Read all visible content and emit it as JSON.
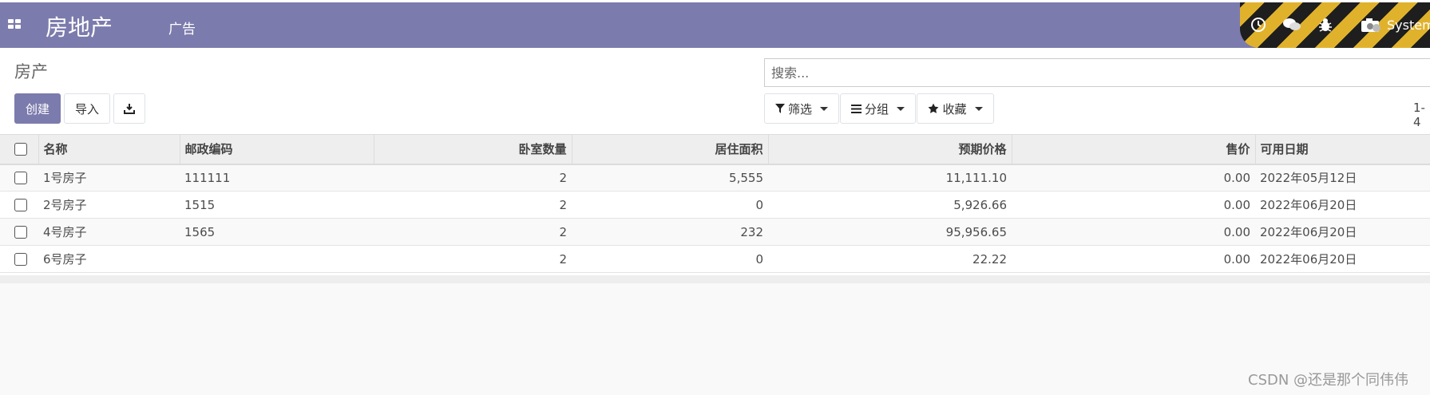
{
  "navbar": {
    "brand": "房地产",
    "menu": [
      "广告"
    ],
    "user": "System"
  },
  "control_panel": {
    "breadcrumb": "房产",
    "create_label": "创建",
    "import_label": "导入",
    "search_placeholder": "搜索...",
    "filter_label": "筛选",
    "groupby_label": "分组",
    "favorites_label": "收藏",
    "pager": "1-4"
  },
  "table": {
    "columns": [
      "名称",
      "邮政编码",
      "卧室数量",
      "居住面积",
      "预期价格",
      "售价",
      "可用日期"
    ],
    "rows": [
      {
        "name": "1号房子",
        "postcode": "111111",
        "bedrooms": "2",
        "living_area": "5,555",
        "expected_price": "11,111.10",
        "selling_price": "0.00",
        "date": "2022年05月12日"
      },
      {
        "name": "2号房子",
        "postcode": "1515",
        "bedrooms": "2",
        "living_area": "0",
        "expected_price": "5,926.66",
        "selling_price": "0.00",
        "date": "2022年06月20日"
      },
      {
        "name": "4号房子",
        "postcode": "1565",
        "bedrooms": "2",
        "living_area": "232",
        "expected_price": "95,956.65",
        "selling_price": "0.00",
        "date": "2022年06月20日"
      },
      {
        "name": "6号房子",
        "postcode": "",
        "bedrooms": "2",
        "living_area": "0",
        "expected_price": "22.22",
        "selling_price": "0.00",
        "date": "2022年06月20日"
      }
    ]
  },
  "watermark": "CSDN @还是那个同伟伟",
  "colors": {
    "brand": "#7c7bad",
    "header_bg": "#eeeeee"
  },
  "icons": [
    "apps-icon",
    "clock-icon",
    "chat-icon",
    "bug-icon",
    "camera-icon",
    "download-icon",
    "filter-icon",
    "list-icon",
    "star-icon"
  ]
}
